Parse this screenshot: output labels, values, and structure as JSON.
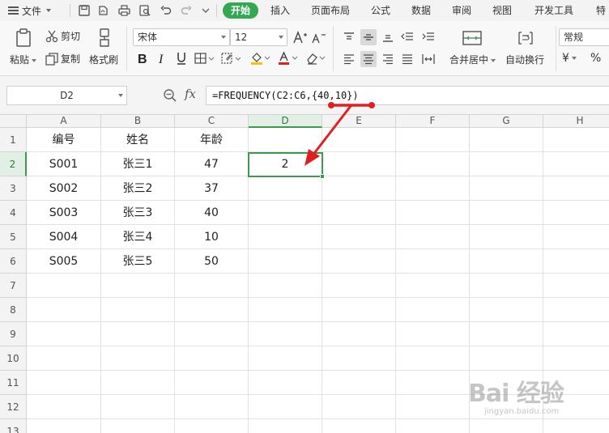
{
  "menubar": {
    "file_label": "文件",
    "tabs": [
      "开始",
      "插入",
      "页面布局",
      "公式",
      "数据",
      "审阅",
      "视图",
      "开发工具",
      "特"
    ]
  },
  "ribbon": {
    "paste_label": "粘贴",
    "cut_label": "剪切",
    "copy_label": "复制",
    "format_painter_label": "格式刷",
    "font_name": "宋体",
    "font_size": "12",
    "merge_center_label": "合并居中",
    "wrap_text_label": "自动换行",
    "number_format": "常规",
    "currency_symbol": "¥",
    "percent_symbol": "%"
  },
  "formula_bar": {
    "name_box": "D2",
    "fx_label": "fx",
    "formula": "=FREQUENCY(C2:C6,{40,10})"
  },
  "sheet": {
    "columns": [
      "A",
      "B",
      "C",
      "D",
      "E",
      "F",
      "G",
      "H"
    ],
    "active_column": "D",
    "row_numbers": [
      "1",
      "2",
      "3",
      "4",
      "5",
      "6",
      "7",
      "8",
      "9",
      "10",
      "11",
      "12",
      "13"
    ],
    "active_row": "2",
    "headers": [
      "编号",
      "姓名",
      "年龄"
    ],
    "rows": [
      [
        "S001",
        "张三1",
        "47",
        "2"
      ],
      [
        "S002",
        "张三2",
        "37",
        ""
      ],
      [
        "S003",
        "张三3",
        "40",
        ""
      ],
      [
        "S004",
        "张三4",
        "10",
        ""
      ],
      [
        "S005",
        "张三5",
        "50",
        ""
      ]
    ]
  },
  "annotation": {
    "color": "#e02020"
  },
  "watermark": {
    "main": "Bai 经验",
    "sub": "jingyan.baidu.com"
  },
  "colors": {
    "accent_green": "#33a852",
    "selection_green": "#3a9b4e",
    "arrow_red": "#e02020"
  }
}
